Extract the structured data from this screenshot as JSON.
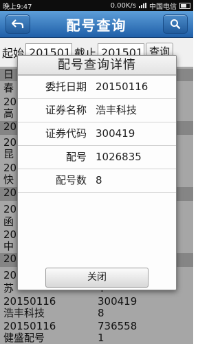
{
  "status_bar": {
    "time": "晚上9:47",
    "speed": "0.00K/s",
    "carrier": "中国电信"
  },
  "header": {
    "title": "配号查询",
    "back_icon": "back-arrow-icon",
    "search_icon": "search-icon"
  },
  "query": {
    "start_label": "起始",
    "start_value": "201501",
    "end_label": "截止",
    "end_value": "201501",
    "query_button": "查询"
  },
  "list": {
    "header_col": "日",
    "rows": [
      {
        "c1": "春",
        "c2": ""
      },
      {
        "c1": "20",
        "c2": ""
      },
      {
        "c1": "高",
        "c2": ""
      },
      {
        "c1": "201",
        "c2": ""
      },
      {
        "c1": "20",
        "c2": ""
      },
      {
        "c1": "昆",
        "c2": ""
      },
      {
        "c1": "20",
        "c2": ""
      },
      {
        "c1": "快",
        "c2": ""
      },
      {
        "c1": "201",
        "c2": ""
      },
      {
        "c1": "20",
        "c2": ""
      },
      {
        "c1": "函",
        "c2": ""
      },
      {
        "c1": "20",
        "c2": ""
      },
      {
        "c1": "中",
        "c2": ""
      },
      {
        "c1": "201",
        "c2": ""
      },
      {
        "c1": "20",
        "c2": ""
      },
      {
        "c1": "苏",
        "c2": "4"
      },
      {
        "c1": "20150116",
        "c2": "300419"
      },
      {
        "c1": "浩丰科技",
        "c2": "8"
      },
      {
        "c1": "20150116",
        "c2": "736558"
      },
      {
        "c1": "健盛配号",
        "c2": "1"
      }
    ]
  },
  "dialog": {
    "title": "配号查询详情",
    "fields": [
      {
        "label": "委托日期",
        "value": "20150116"
      },
      {
        "label": "证券名称",
        "value": "浩丰科技"
      },
      {
        "label": "证券代码",
        "value": "300419"
      },
      {
        "label": "配号",
        "value": "1026835"
      },
      {
        "label": "配号数",
        "value": "8"
      }
    ],
    "close_button": "关闭"
  }
}
